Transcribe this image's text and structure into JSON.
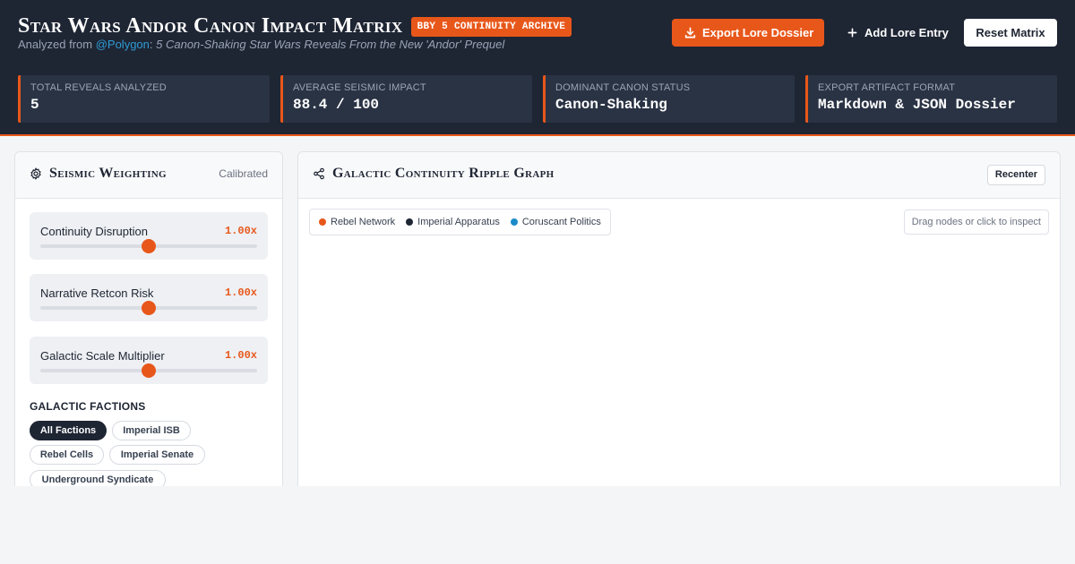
{
  "header": {
    "title": "Star Wars Andor Canon Impact Matrix",
    "badge": "BBY 5 CONTINUITY ARCHIVE",
    "subtitle_prefix": "Analyzed from ",
    "source_handle": "@Polygon",
    "subtitle_sep": ": ",
    "source_headline": "5 Canon-Shaking Star Wars Reveals From the New 'Andor' Prequel",
    "export_label": "Export Lore Dossier",
    "add_label": "Add Lore Entry",
    "reset_label": "Reset Matrix"
  },
  "stats": [
    {
      "label": "TOTAL REVEALS ANALYZED",
      "value": "5"
    },
    {
      "label": "AVERAGE SEISMIC IMPACT",
      "value": "88.4 / 100"
    },
    {
      "label": "DOMINANT CANON STATUS",
      "value": "Canon-Shaking"
    },
    {
      "label": "EXPORT ARTIFACT FORMAT",
      "value": "Markdown & JSON Dossier"
    }
  ],
  "weighting": {
    "title": "Seismic Weighting",
    "status": "Calibrated",
    "sliders": [
      {
        "label": "Continuity Disruption",
        "value": "1.00x",
        "level": 0.5
      },
      {
        "label": "Narrative Retcon Risk",
        "value": "1.00x",
        "level": 0.5
      },
      {
        "label": "Galactic Scale Multiplier",
        "value": "1.00x",
        "level": 0.5
      }
    ],
    "factions_heading": "GALACTIC FACTIONS",
    "factions": [
      "All Factions",
      "Imperial ISB",
      "Rebel Cells",
      "Imperial Senate",
      "Underground Syndicate"
    ],
    "active_faction": "All Factions"
  },
  "graph": {
    "title": "Galactic Continuity Ripple Graph",
    "recenter_label": "Recenter",
    "hint": "Drag nodes or click to inspect",
    "legend": [
      {
        "label": "Rebel Network",
        "color": "#e8571a"
      },
      {
        "label": "Imperial Apparatus",
        "color": "#1e2533"
      },
      {
        "label": "Coruscant Politics",
        "color": "#1c8bc8"
      }
    ]
  },
  "colors": {
    "accent": "#e8571a",
    "navy": "#1e2533",
    "link": "#2f9bd6"
  },
  "icons": {
    "export": "download-icon",
    "add": "plus-icon",
    "weighting": "gear-icon",
    "graph": "share-nodes-icon"
  }
}
